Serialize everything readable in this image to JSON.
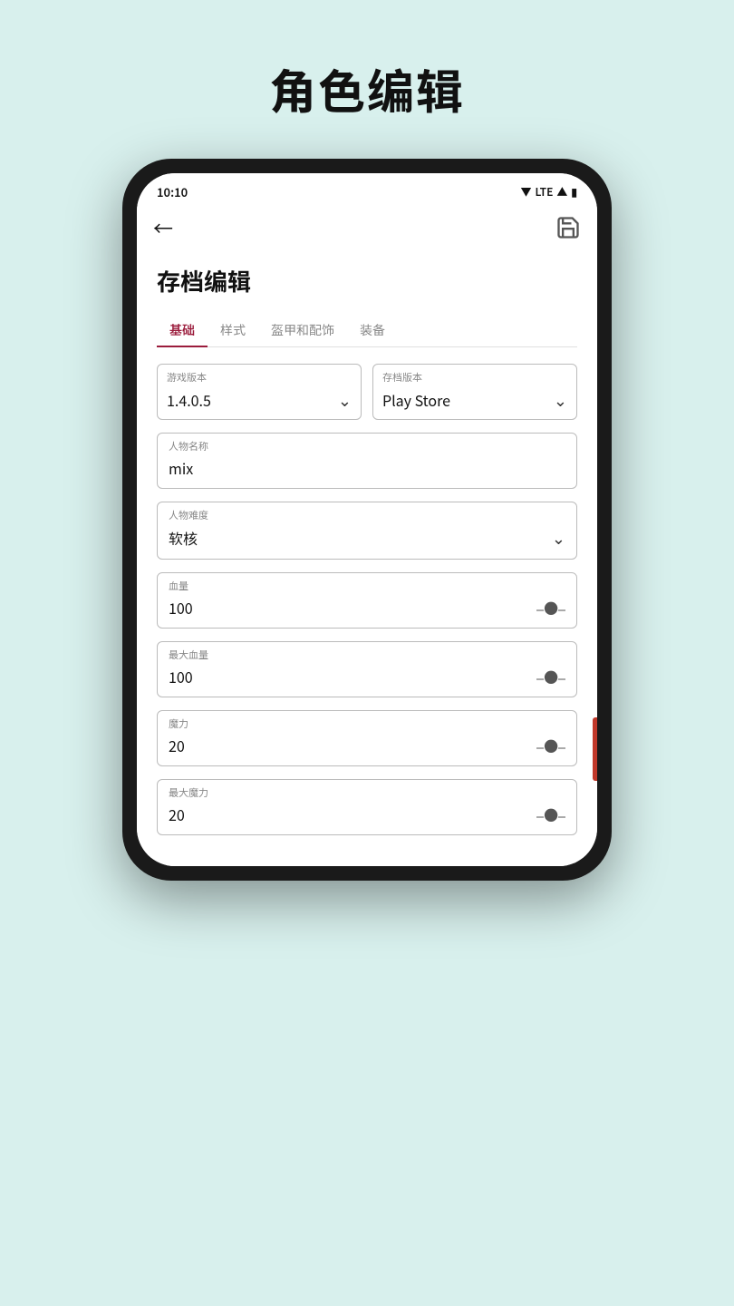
{
  "page": {
    "title": "角色编辑",
    "background_color": "#d8f0ed"
  },
  "status_bar": {
    "time": "10:10",
    "signal": "▼",
    "network": "LTE",
    "signal_bars": "▲",
    "battery": "▮"
  },
  "top_bar": {
    "back_label": "←",
    "save_label": "💾"
  },
  "content": {
    "section_title": "存档编辑",
    "tabs": [
      {
        "label": "基础",
        "active": true
      },
      {
        "label": "样式",
        "active": false
      },
      {
        "label": "盔甲和配饰",
        "active": false
      },
      {
        "label": "装备",
        "active": false
      }
    ],
    "game_version": {
      "label": "游戏版本",
      "value": "1.4.0.5"
    },
    "save_version": {
      "label": "存档版本",
      "value": "Play Store"
    },
    "character_name": {
      "label": "人物名称",
      "value": "mix"
    },
    "character_difficulty": {
      "label": "人物难度",
      "value": "软核"
    },
    "health": {
      "label": "血量",
      "value": "100"
    },
    "max_health": {
      "label": "最大血量",
      "value": "100"
    },
    "mana": {
      "label": "魔力",
      "value": "20"
    },
    "max_mana": {
      "label": "最大魔力",
      "value": "20"
    }
  }
}
